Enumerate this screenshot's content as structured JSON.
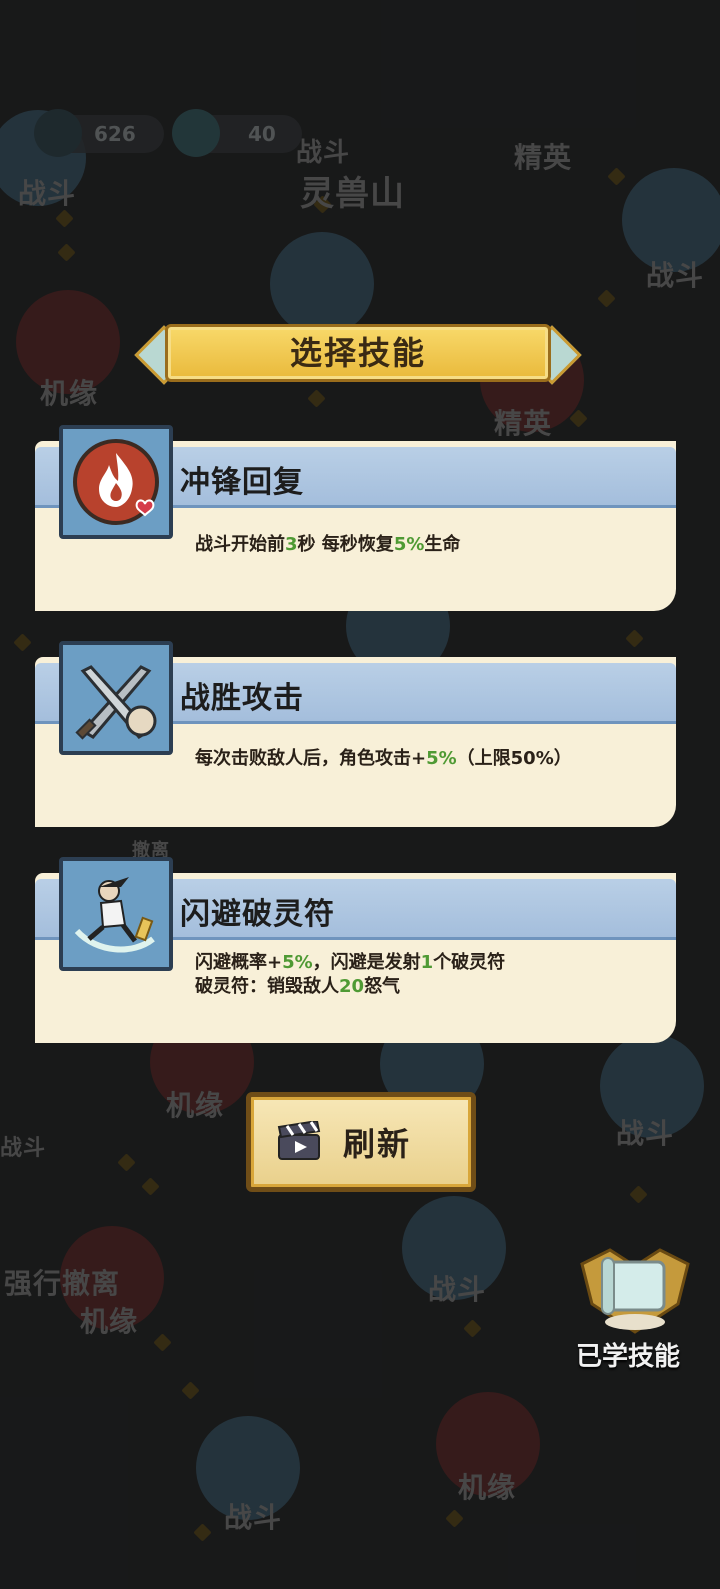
{
  "map": {
    "hud_values": [
      "626",
      "40"
    ],
    "area_name": "灵兽山",
    "node_labels": [
      "战斗",
      "战斗",
      "精英",
      "战斗",
      "机缘",
      "精英",
      "撤离",
      "机缘",
      "战斗",
      "强行撤离",
      "机缘",
      "战斗",
      "战斗",
      "机缘",
      "战斗"
    ]
  },
  "dialog": {
    "title": "选择技能",
    "skills": [
      {
        "name": "冲锋回复",
        "icon": "fire-heart-icon",
        "desc_lines": [
          [
            {
              "t": "战斗开始前"
            },
            {
              "t": "3",
              "hl": true
            },
            {
              "t": "秒 每秒恢复"
            },
            {
              "t": "5%",
              "hl": true
            },
            {
              "t": "生命"
            }
          ]
        ]
      },
      {
        "name": "战胜攻击",
        "icon": "crossed-swords-fist-icon",
        "desc_lines": [
          [
            {
              "t": "每次击败敌人后，角色攻击+"
            },
            {
              "t": "5%",
              "hl": true
            },
            {
              "t": "（上限50%）"
            }
          ]
        ]
      },
      {
        "name": "闪避破灵符",
        "icon": "dodging-ninja-talisman-icon",
        "desc_lines": [
          [
            {
              "t": "闪避概率+"
            },
            {
              "t": "5%",
              "hl": true
            },
            {
              "t": "，闪避是发射"
            },
            {
              "t": "1",
              "hl": true
            },
            {
              "t": "个破灵符"
            }
          ],
          [
            {
              "t": "破灵符：销毁敌人"
            },
            {
              "t": "20",
              "hl": true
            },
            {
              "t": "怒气"
            }
          ]
        ]
      }
    ],
    "refresh_label": "刷新",
    "refresh_icon": "clapperboard-icon"
  },
  "learned_skills": {
    "label": "已学技能",
    "icon": "scroll-icon"
  },
  "colors": {
    "highlight": "#4f9a34",
    "card_header": "#a9c2dd",
    "card_body": "#f8f0d8",
    "banner_gold": "#f2cf55"
  }
}
